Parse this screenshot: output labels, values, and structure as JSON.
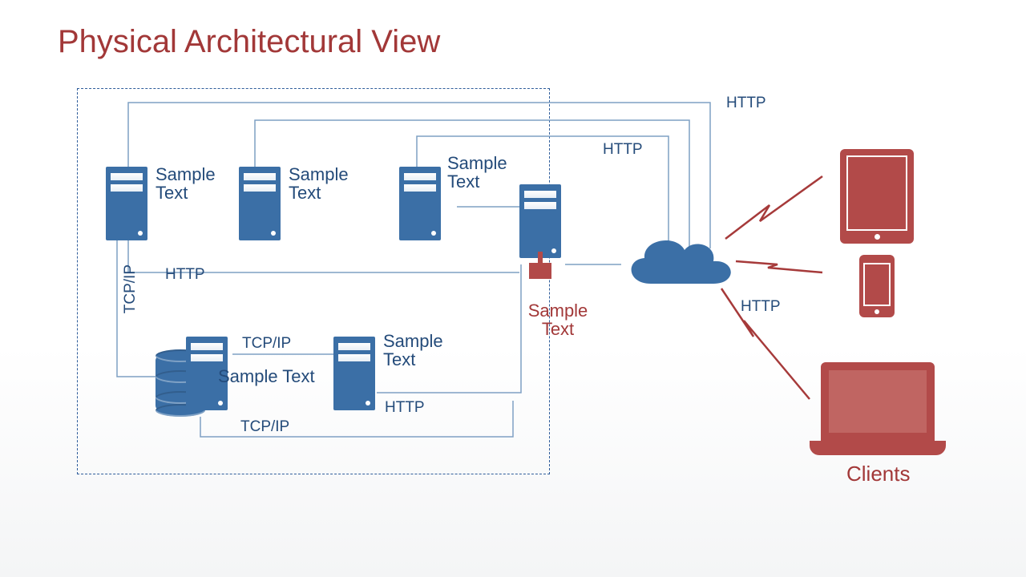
{
  "title": "Physical Architectural View",
  "colors": {
    "accent_blue": "#3b6fa6",
    "accent_red": "#a23838",
    "line": "#7fa0c4"
  },
  "servers": {
    "s1": {
      "label": "Sample Text"
    },
    "s2": {
      "label": "Sample Text"
    },
    "s3": {
      "label": "Sample Text"
    },
    "s4": {
      "label": "Sample Text"
    },
    "s5": {
      "label": "Sample Text"
    }
  },
  "gateway": {
    "label": "Sample Text"
  },
  "edges": {
    "http_top": "HTTP",
    "http_right": "HTTP",
    "http_inside_top": "HTTP",
    "http_row": "HTTP",
    "http_bottom": "HTTP",
    "tcpip_left": "TCP/IP",
    "tcpip_mid": "TCP/IP",
    "tcpip_bottom": "TCP/IP",
    "http_cloud": "HTTP"
  },
  "clients_label": "Clients"
}
